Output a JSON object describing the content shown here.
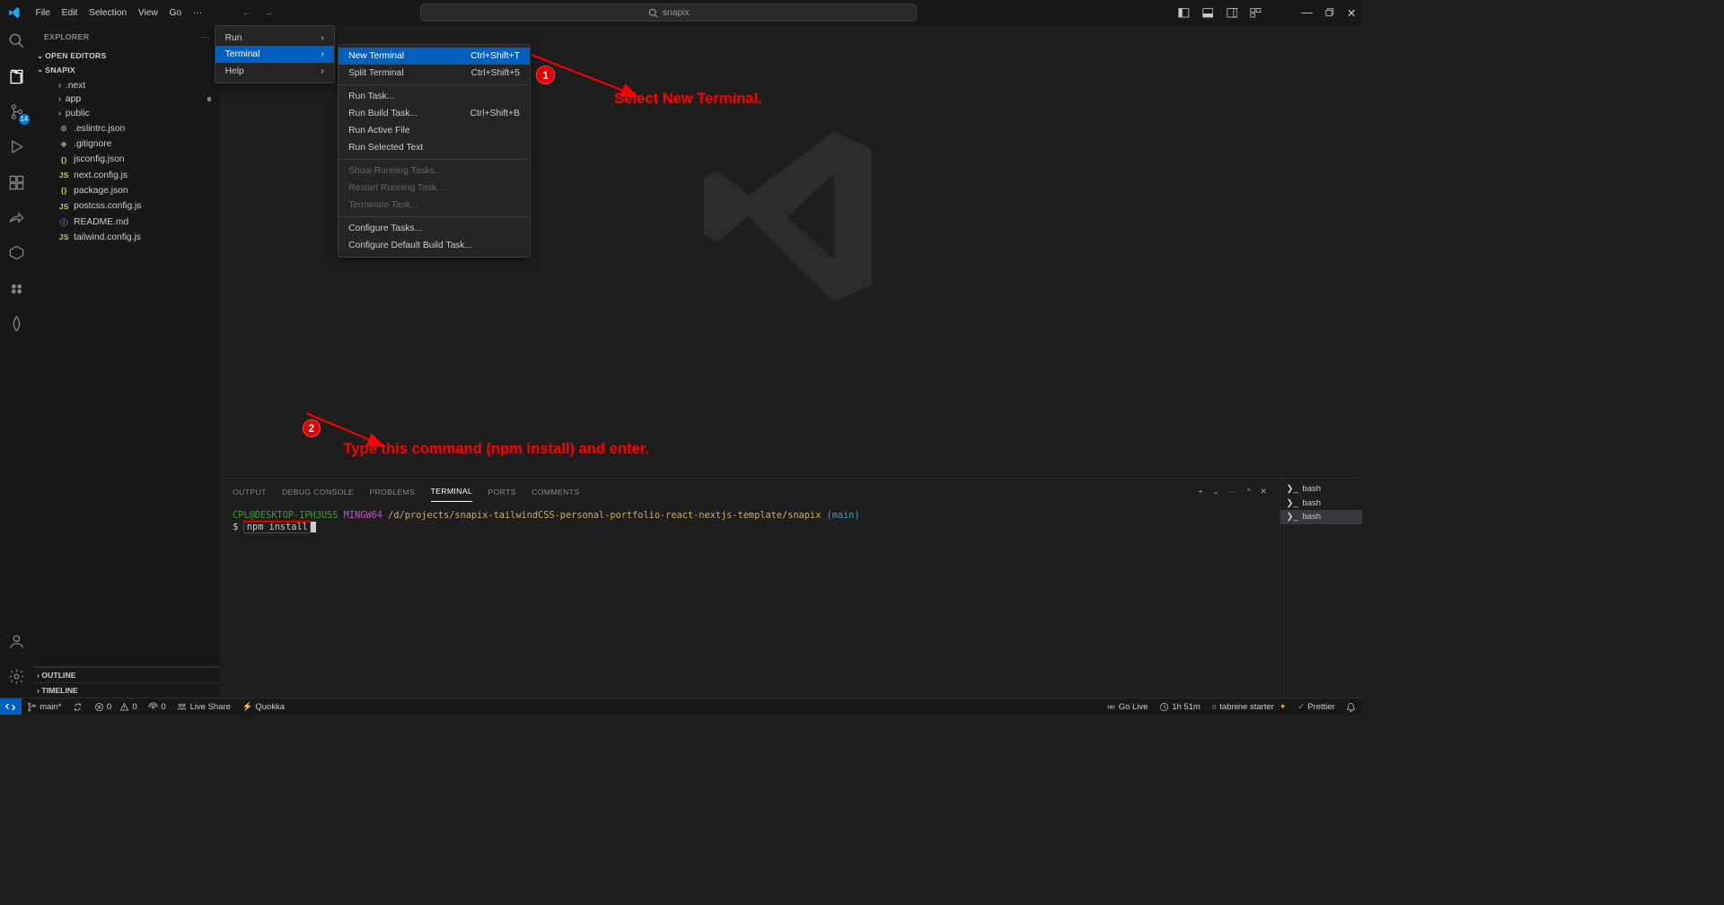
{
  "menubar": {
    "file": "File",
    "edit": "Edit",
    "selection": "Selection",
    "view": "View",
    "go": "Go"
  },
  "search": {
    "text": "snapix"
  },
  "dropdown": {
    "run": "Run",
    "terminal": "Terminal",
    "help": "Help"
  },
  "submenu": {
    "new_terminal": "New Terminal",
    "new_terminal_kbd": "Ctrl+Shift+T",
    "split_terminal": "Split Terminal",
    "split_terminal_kbd": "Ctrl+Shift+5",
    "run_task": "Run Task...",
    "run_build_task": "Run Build Task...",
    "run_build_task_kbd": "Ctrl+Shift+B",
    "run_active_file": "Run Active File",
    "run_selected_text": "Run Selected Text",
    "show_running": "Show Running Tasks...",
    "restart_running": "Restart Running Task...",
    "terminate_task": "Terminate Task...",
    "configure_tasks": "Configure Tasks...",
    "configure_default": "Configure Default Build Task..."
  },
  "sidebar": {
    "title": "EXPLORER",
    "open_editors": "OPEN EDITORS",
    "root": "SNAPIX",
    "folders": [
      {
        "name": ".next",
        "type": "folder"
      },
      {
        "name": "app",
        "type": "folder",
        "modified": true,
        "selected": true
      },
      {
        "name": "public",
        "type": "folder"
      }
    ],
    "files": [
      {
        "name": ".eslintrc.json",
        "icon": "gear"
      },
      {
        "name": ".gitignore",
        "icon": "gear"
      },
      {
        "name": "jsconfig.json",
        "icon": "json"
      },
      {
        "name": "next.config.js",
        "icon": "js"
      },
      {
        "name": "package.json",
        "icon": "json"
      },
      {
        "name": "postcss.config.js",
        "icon": "js"
      },
      {
        "name": "README.md",
        "icon": "info"
      },
      {
        "name": "tailwind.config.js",
        "icon": "js"
      }
    ],
    "outline": "OUTLINE",
    "timeline": "TIMELINE"
  },
  "activitybar": {
    "scm_badge": "14"
  },
  "panel": {
    "tabs": {
      "output": "OUTPUT",
      "debug": "DEBUG CONSOLE",
      "problems": "PROBLEMS",
      "terminal": "TERMINAL",
      "ports": "PORTS",
      "comments": "COMMENTS"
    }
  },
  "terminal": {
    "user": "CPL@DESKTOP-IPH3U5S",
    "host": "MINGW64",
    "path": "/d/projects/snapix-tailwindCSS-personal-portfolio-react-nextjs-template/snapix",
    "branch": "(main)",
    "prompt": "$",
    "command": "npm install"
  },
  "terminal_list": {
    "bash": "bash"
  },
  "statusbar": {
    "branch": "main*",
    "sync": "",
    "errors": "0",
    "warnings": "0",
    "ports": "0",
    "liveshare": "Live Share",
    "quokka": "Quokka",
    "golive": "Go Live",
    "time": "1h 51m",
    "tabnine": "tabnine starter",
    "prettier": "Prettier"
  },
  "annotations": {
    "a1": "Select New Terminal.",
    "a2": "Type this command (npm install) and enter.",
    "b1": "1",
    "b2": "2"
  }
}
